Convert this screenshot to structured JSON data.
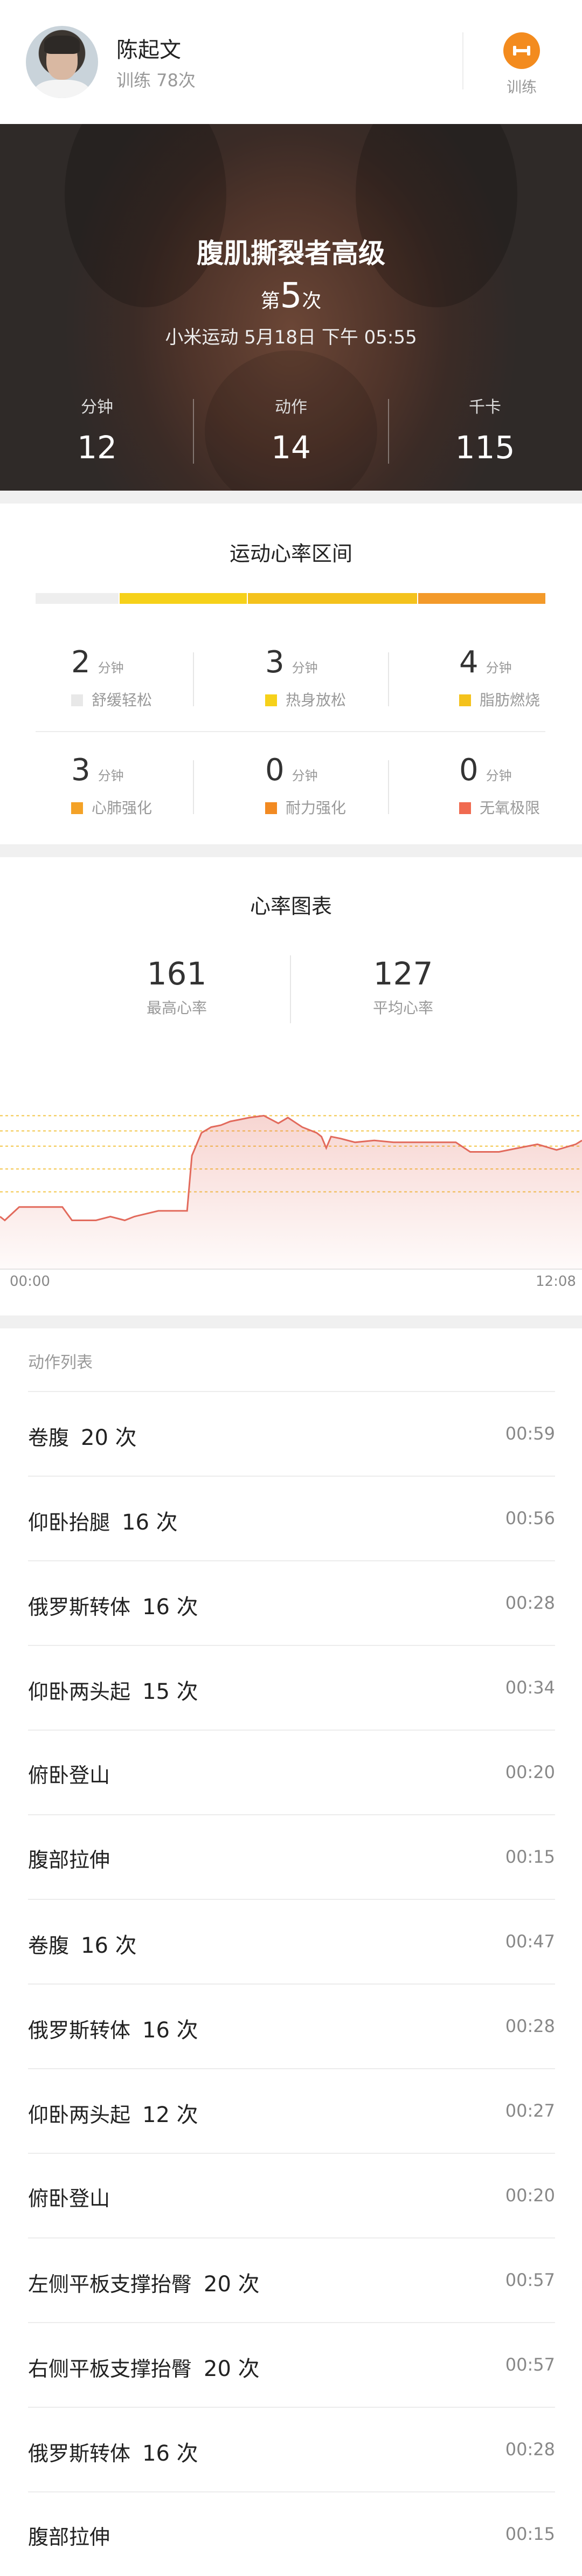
{
  "user": {
    "name": "陈起文",
    "trainings": "训练 78次"
  },
  "header": {
    "train_label": "训练",
    "accent": "#f38b1e"
  },
  "hero": {
    "title": "腹肌撕裂者高级",
    "count_prefix": "第",
    "count_value": "5",
    "count_suffix": "次",
    "date": "小米运动 5月18日 下午 05:55",
    "stats": [
      {
        "label": "分钟",
        "value": "12"
      },
      {
        "label": "动作",
        "value": "14"
      },
      {
        "label": "千卡",
        "value": "115"
      }
    ]
  },
  "heart_zones": {
    "title": "运动心率区间",
    "bar_colors": [
      "#eeeeee",
      "#f6d11a",
      "#f4c21c",
      "#f39a2a"
    ],
    "zones": [
      {
        "value": "2",
        "unit": "分钟",
        "label": "舒缓轻松",
        "color": "#e8e8e8"
      },
      {
        "value": "3",
        "unit": "分钟",
        "label": "热身放松",
        "color": "#f6d11a"
      },
      {
        "value": "4",
        "unit": "分钟",
        "label": "脂肪燃烧",
        "color": "#f4c21c"
      },
      {
        "value": "3",
        "unit": "分钟",
        "label": "心肺强化",
        "color": "#f4a227"
      },
      {
        "value": "0",
        "unit": "分钟",
        "label": "耐力强化",
        "color": "#f28a22"
      },
      {
        "value": "0",
        "unit": "分钟",
        "label": "无氧极限",
        "color": "#f06a50"
      }
    ]
  },
  "heart_chart": {
    "title": "心率图表",
    "max_value": "161",
    "max_label": "最高心率",
    "avg_value": "127",
    "avg_label": "平均心率",
    "start_time": "00:00",
    "end_time": "12:08"
  },
  "chart_data": {
    "type": "area",
    "x": [
      0.0,
      0.1,
      0.4,
      0.6,
      0.8,
      1.3,
      1.5,
      2.0,
      2.3,
      2.6,
      2.8,
      3.3,
      3.9,
      4.0,
      4.2,
      4.4,
      4.6,
      4.8,
      5.0,
      5.2,
      5.5,
      5.8,
      6.0,
      6.3,
      6.6,
      6.7,
      6.8,
      6.9,
      7.1,
      7.4,
      7.8,
      8.2,
      8.5,
      8.9,
      9.2,
      9.5,
      9.8,
      10.0,
      10.4,
      10.8,
      11.2,
      11.6,
      12.0,
      12.13
    ],
    "y": [
      108,
      106,
      113,
      113,
      113,
      113,
      106,
      106,
      108,
      106,
      108,
      111,
      111,
      140,
      152,
      155,
      156,
      158,
      159,
      160,
      161,
      157,
      160,
      155,
      152,
      150,
      144,
      150,
      149,
      147,
      148,
      147,
      147,
      147,
      147,
      147,
      142,
      142,
      142,
      144,
      146,
      143,
      146,
      148
    ],
    "xlabel": "",
    "ylabel": "",
    "xlim": [
      0,
      12.13
    ],
    "ylim": [
      90,
      175
    ],
    "reference_lines": [
      161,
      153,
      145,
      133,
      121
    ],
    "grid": false,
    "color": "#e26a5c"
  },
  "action_list": {
    "title": "动作列表",
    "items": [
      {
        "name": "卷腹",
        "count": "20 次",
        "time": "00:59"
      },
      {
        "name": "仰卧抬腿",
        "count": "16 次",
        "time": "00:56"
      },
      {
        "name": "俄罗斯转体",
        "count": "16 次",
        "time": "00:28"
      },
      {
        "name": "仰卧两头起",
        "count": "15 次",
        "time": "00:34"
      },
      {
        "name": "俯卧登山",
        "count": "",
        "time": "00:20"
      },
      {
        "name": "腹部拉伸",
        "count": "",
        "time": "00:15"
      },
      {
        "name": "卷腹",
        "count": "16 次",
        "time": "00:47"
      },
      {
        "name": "俄罗斯转体",
        "count": "16 次",
        "time": "00:28"
      },
      {
        "name": "仰卧两头起",
        "count": "12 次",
        "time": "00:27"
      },
      {
        "name": "俯卧登山",
        "count": "",
        "time": "00:20"
      },
      {
        "name": "左侧平板支撑抬臀",
        "count": "20 次",
        "time": "00:57"
      },
      {
        "name": "右侧平板支撑抬臀",
        "count": "20 次",
        "time": "00:57"
      },
      {
        "name": "俄罗斯转体",
        "count": "16 次",
        "time": "00:28"
      },
      {
        "name": "腹部拉伸",
        "count": "",
        "time": "00:15"
      }
    ]
  }
}
